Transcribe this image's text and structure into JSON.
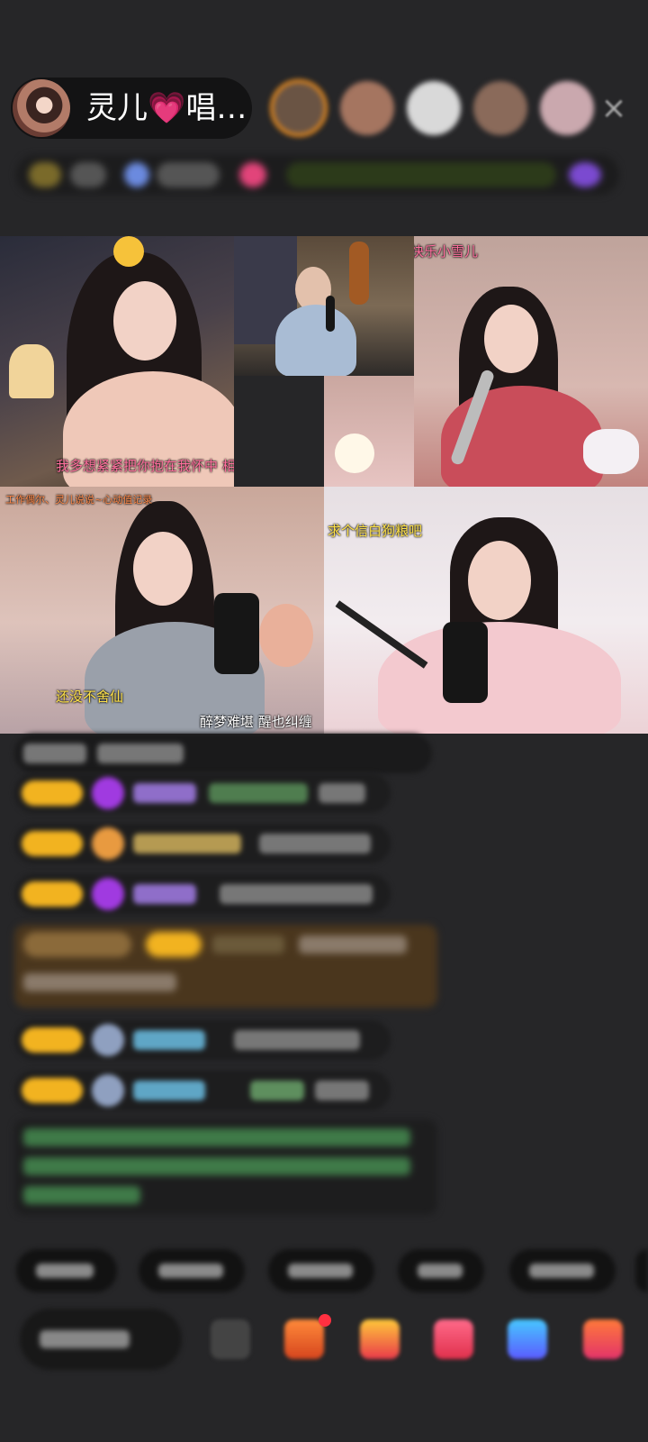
{
  "host": {
    "name": "灵儿💗唱…"
  },
  "viewers": [
    {
      "icon": "viewer-avatar"
    },
    {
      "icon": "viewer-avatar"
    },
    {
      "icon": "viewer-avatar"
    },
    {
      "icon": "viewer-avatar"
    },
    {
      "icon": "viewer-avatar"
    }
  ],
  "close_icon": "×",
  "video_captions": {
    "tile1": "我多想紧紧把你抱在我怀中 相拥",
    "tile4": "快乐小雪儿",
    "tile5_top": "工作偶尔、灵儿说说~心动值记录",
    "tile5_bottom_left": "还没不舍仙",
    "tile5_bottom_right": "醉梦难堪 醒也纠缠",
    "tile6": "求个信白狗粮吧"
  },
  "colors": {
    "background": "#262628",
    "badge": "#f2b320",
    "gift_row": "#4a361d",
    "notify_dot": "#ff3040"
  }
}
